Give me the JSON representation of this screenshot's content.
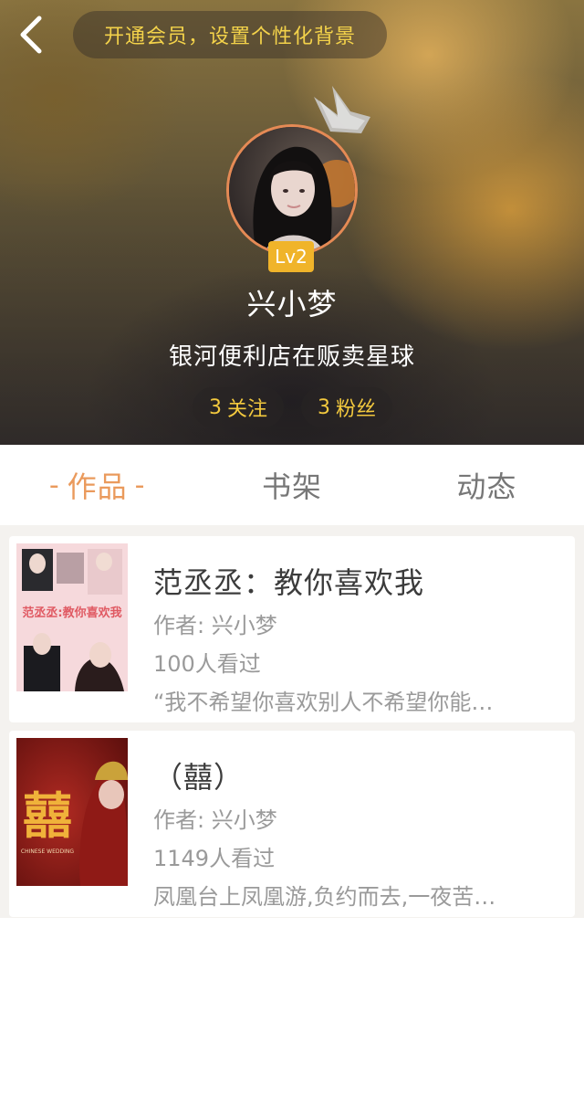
{
  "header": {
    "vip_prompt": "开通会员，设置个性化背景"
  },
  "profile": {
    "level": "Lv2",
    "name": "兴小梦",
    "signature": "银河便利店在贩卖星球",
    "following": {
      "count": "3",
      "label": "关注"
    },
    "fans": {
      "count": "3",
      "label": "粉丝"
    }
  },
  "tabs": [
    {
      "label": "作品",
      "active": true
    },
    {
      "label": "书架",
      "active": false
    },
    {
      "label": "动态",
      "active": false
    }
  ],
  "books": [
    {
      "title": "范丞丞：教你喜欢我",
      "author": "作者: 兴小梦",
      "views": "100人看过",
      "description": "“我不希望你喜欢别人不希望你能…",
      "cover_text": "范丞丞:教你喜欢我"
    },
    {
      "title": "（囍）",
      "author": "作者: 兴小梦",
      "views": "1149人看过",
      "description": "凤凰台上凤凰游,负约而去,一夜苦…",
      "cover_text": "囍",
      "cover_subtext": "CHINESE WEDDING"
    }
  ],
  "colors": {
    "accent_orange": "#ea9a5c",
    "gold_text": "#f3d24a",
    "level_badge": "#f0b42a",
    "muted_text": "#9a9a9a"
  },
  "icons": {
    "back": "chevron-left-icon",
    "crown": "crown-icon"
  }
}
